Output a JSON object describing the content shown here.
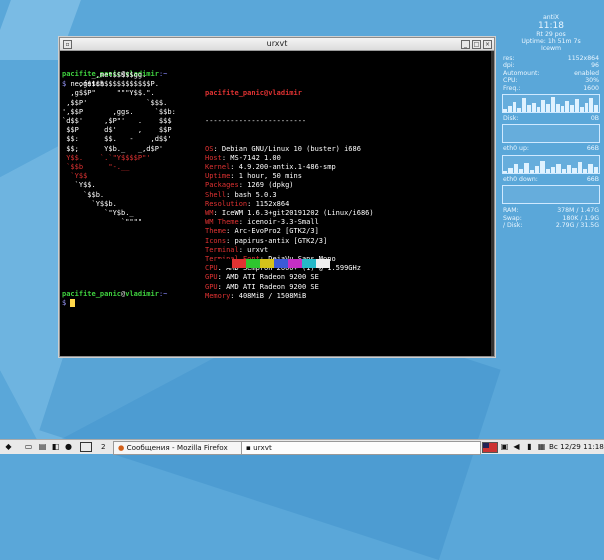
{
  "window": {
    "title": "urxvt"
  },
  "terminal": {
    "prompt_user": "pacifite_panic",
    "prompt_at": "@",
    "prompt_host": "vladimir",
    "prompt_path": ":~",
    "prompt_symbol": "$",
    "command": "neofetch",
    "header": "pacifite_panic@vladimir",
    "separator": "------------------------",
    "info": [
      {
        "key": "OS",
        "value": ": Debian GNU/Linux 10 (buster) i686"
      },
      {
        "key": "Host",
        "value": ": MS-7142 1.00"
      },
      {
        "key": "Kernel",
        "value": ": 4.9.200-antix.1-486-smp"
      },
      {
        "key": "Uptime",
        "value": ": 1 hour, 50 mins"
      },
      {
        "key": "Packages",
        "value": ": 1269 (dpkg)"
      },
      {
        "key": "Shell",
        "value": ": bash 5.0.3"
      },
      {
        "key": "Resolution",
        "value": ": 1152x864"
      },
      {
        "key": "WM",
        "value": ": IceWM 1.6.3+git20191202 (Linux/i686)"
      },
      {
        "key": "WM Theme",
        "value": ": icenoir-3.3-Small"
      },
      {
        "key": "Theme",
        "value": ": Arc-EvoPro2 [GTK2/3]"
      },
      {
        "key": "Icons",
        "value": ": papirus-antix [GTK2/3]"
      },
      {
        "key": "Terminal",
        "value": ": urxvt"
      },
      {
        "key": "Terminal Font",
        "value": ": DejaVu Sans Mono"
      },
      {
        "key": "CPU",
        "value": ": AMD Sempron 2600+ (1) @ 1.599GHz"
      },
      {
        "key": "GPU",
        "value": ": AMD ATI Radeon 9200 SE"
      },
      {
        "key": "GPU",
        "value": ": AMD ATI Radeon 9200 SE"
      },
      {
        "key": "Memory",
        "value": ": 408MiB / 1508MiB"
      }
    ],
    "logo_lines": [
      "       _,met$$$$$gg.",
      "    ,g$$$$$$$$$$$$$$$P.",
      "  ,g$$P\"     \"\"\"Y$$.\".",
      " ,$$P'              `$$$.",
      "',$$P       ,ggs.     `$$b:",
      "`d$$'     ,$P\"'   .    $$$",
      " $$P      d$'     ,    $$P",
      " $$:      $$.   -    ,d$$'",
      " $$;      Y$b._   _,d$P'",
      " Y$$.    `.`\"Y$$$$P\"'",
      " `$$b      \"-.__",
      "  `Y$$",
      "   `Y$$.",
      "     `$$b.",
      "       `Y$$b.",
      "          `\"Y$b._",
      "              `\"\"\"\""
    ],
    "swatch_colors": [
      "#000000",
      "#e03232",
      "#2ec52e",
      "#d6c21a",
      "#3b5ad6",
      "#c42fc4",
      "#26b8c8",
      "#f0f0f0"
    ]
  },
  "conky": {
    "host": "antiX",
    "time": "11:18",
    "date": "Rt 29 pos",
    "uptime": "Uptime: 1h 51m 7s",
    "user": "Icewm",
    "stats": [
      {
        "label": "res:",
        "value": "1152x864"
      },
      {
        "label": "dpi:",
        "value": "96"
      },
      {
        "label": "Automount:",
        "value": "enabled"
      },
      {
        "label": "CPU:",
        "value": "30%"
      },
      {
        "label": "Freq.:",
        "value": "1600"
      }
    ],
    "disk_label": "Disk:",
    "disk_value": "0B",
    "eth_up_label": "eth0 up:",
    "eth_up_value": "66B",
    "eth_down_label": "eth0 down:",
    "eth_down_value": "66B",
    "mem": [
      {
        "label": "RAM:",
        "used": "378M",
        "total": "/ 1.47G"
      },
      {
        "label": "Swap:",
        "used": "180K",
        "total": "/ 1.9G"
      },
      {
        "label": "/ Disk:",
        "used": "2.79G",
        "total": "/ 31.5G"
      }
    ]
  },
  "taskbar": {
    "workspace": "2",
    "task_firefox": "Сообщения - Mozilla Firefox",
    "task_urxvt": "urxvt",
    "clock": "Вс 12/29 11:18"
  }
}
